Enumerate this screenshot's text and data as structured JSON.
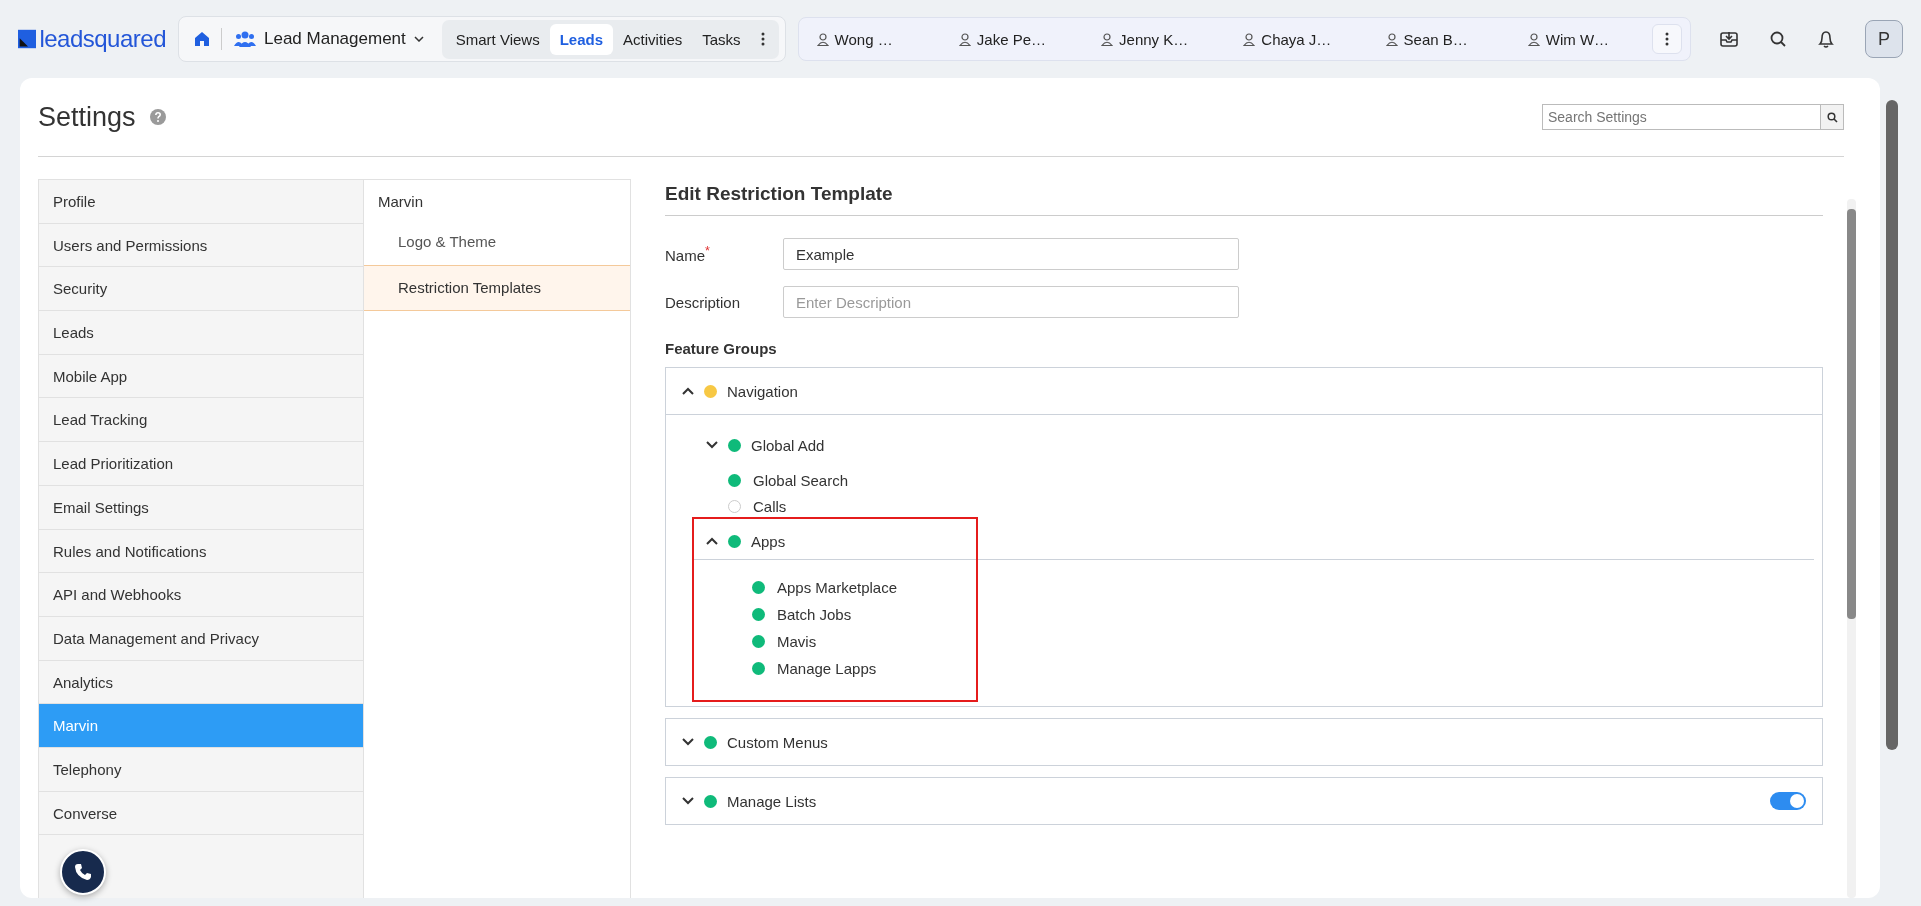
{
  "header": {
    "logo": "leadsquared",
    "module": "Lead Management",
    "tabs": [
      {
        "label": "Smart Views",
        "selected": false
      },
      {
        "label": "Leads",
        "selected": true
      },
      {
        "label": "Activities",
        "selected": false
      },
      {
        "label": "Tasks",
        "selected": false
      }
    ],
    "open_records": [
      "Wong …",
      "Jake Pe…",
      "Jenny K…",
      "Chaya J…",
      "Sean B…",
      "Wim W…"
    ],
    "avatar": "P"
  },
  "settings": {
    "title": "Settings",
    "search": {
      "placeholder": "Search Settings"
    }
  },
  "menu": [
    {
      "label": "Profile",
      "selected": false
    },
    {
      "label": "Users and Permissions",
      "selected": false
    },
    {
      "label": "Security",
      "selected": false
    },
    {
      "label": "Leads",
      "selected": false
    },
    {
      "label": "Mobile App",
      "selected": false
    },
    {
      "label": "Lead Tracking",
      "selected": false
    },
    {
      "label": "Lead Prioritization",
      "selected": false
    },
    {
      "label": "Email Settings",
      "selected": false
    },
    {
      "label": "Rules and Notifications",
      "selected": false
    },
    {
      "label": "API and Webhooks",
      "selected": false
    },
    {
      "label": "Data Management and Privacy",
      "selected": false
    },
    {
      "label": "Analytics",
      "selected": false
    },
    {
      "label": "Marvin",
      "selected": true
    },
    {
      "label": "Telephony",
      "selected": false
    },
    {
      "label": "Converse",
      "selected": false
    }
  ],
  "submenu": {
    "title": "Marvin",
    "items": [
      {
        "label": "Logo & Theme",
        "selected": false
      },
      {
        "label": "Restriction Templates",
        "selected": true
      }
    ]
  },
  "editor": {
    "title": "Edit Restriction Template",
    "fields": [
      {
        "label": "Name",
        "required_mark": "*",
        "value": "Example"
      },
      {
        "label": "Description",
        "placeholder": "Enter Description"
      }
    ],
    "section": "Feature Groups",
    "groups": [
      {
        "label": "Navigation",
        "color": "#f7c844",
        "expanded": true,
        "children": [
          {
            "label": "Global Add",
            "color": "#0fba7a",
            "expanded": false
          },
          {
            "label": "Global Search",
            "color": "#0fba7a"
          },
          {
            "label": "Calls",
            "color": "#ffffff"
          },
          {
            "label": "Apps",
            "color": "#0fba7a",
            "expanded": true,
            "highlighted": true,
            "children": [
              {
                "label": "Apps Marketplace",
                "color": "#0fba7a"
              },
              {
                "label": "Batch Jobs",
                "color": "#0fba7a"
              },
              {
                "label": "Mavis",
                "color": "#0fba7a"
              },
              {
                "label": "Manage Lapps",
                "color": "#0fba7a"
              }
            ]
          }
        ]
      },
      {
        "label": "Custom Menus",
        "color": "#0fba7a",
        "expanded": false
      },
      {
        "label": "Manage Lists",
        "color": "#0fba7a",
        "expanded": false,
        "switch_on": true
      }
    ]
  }
}
